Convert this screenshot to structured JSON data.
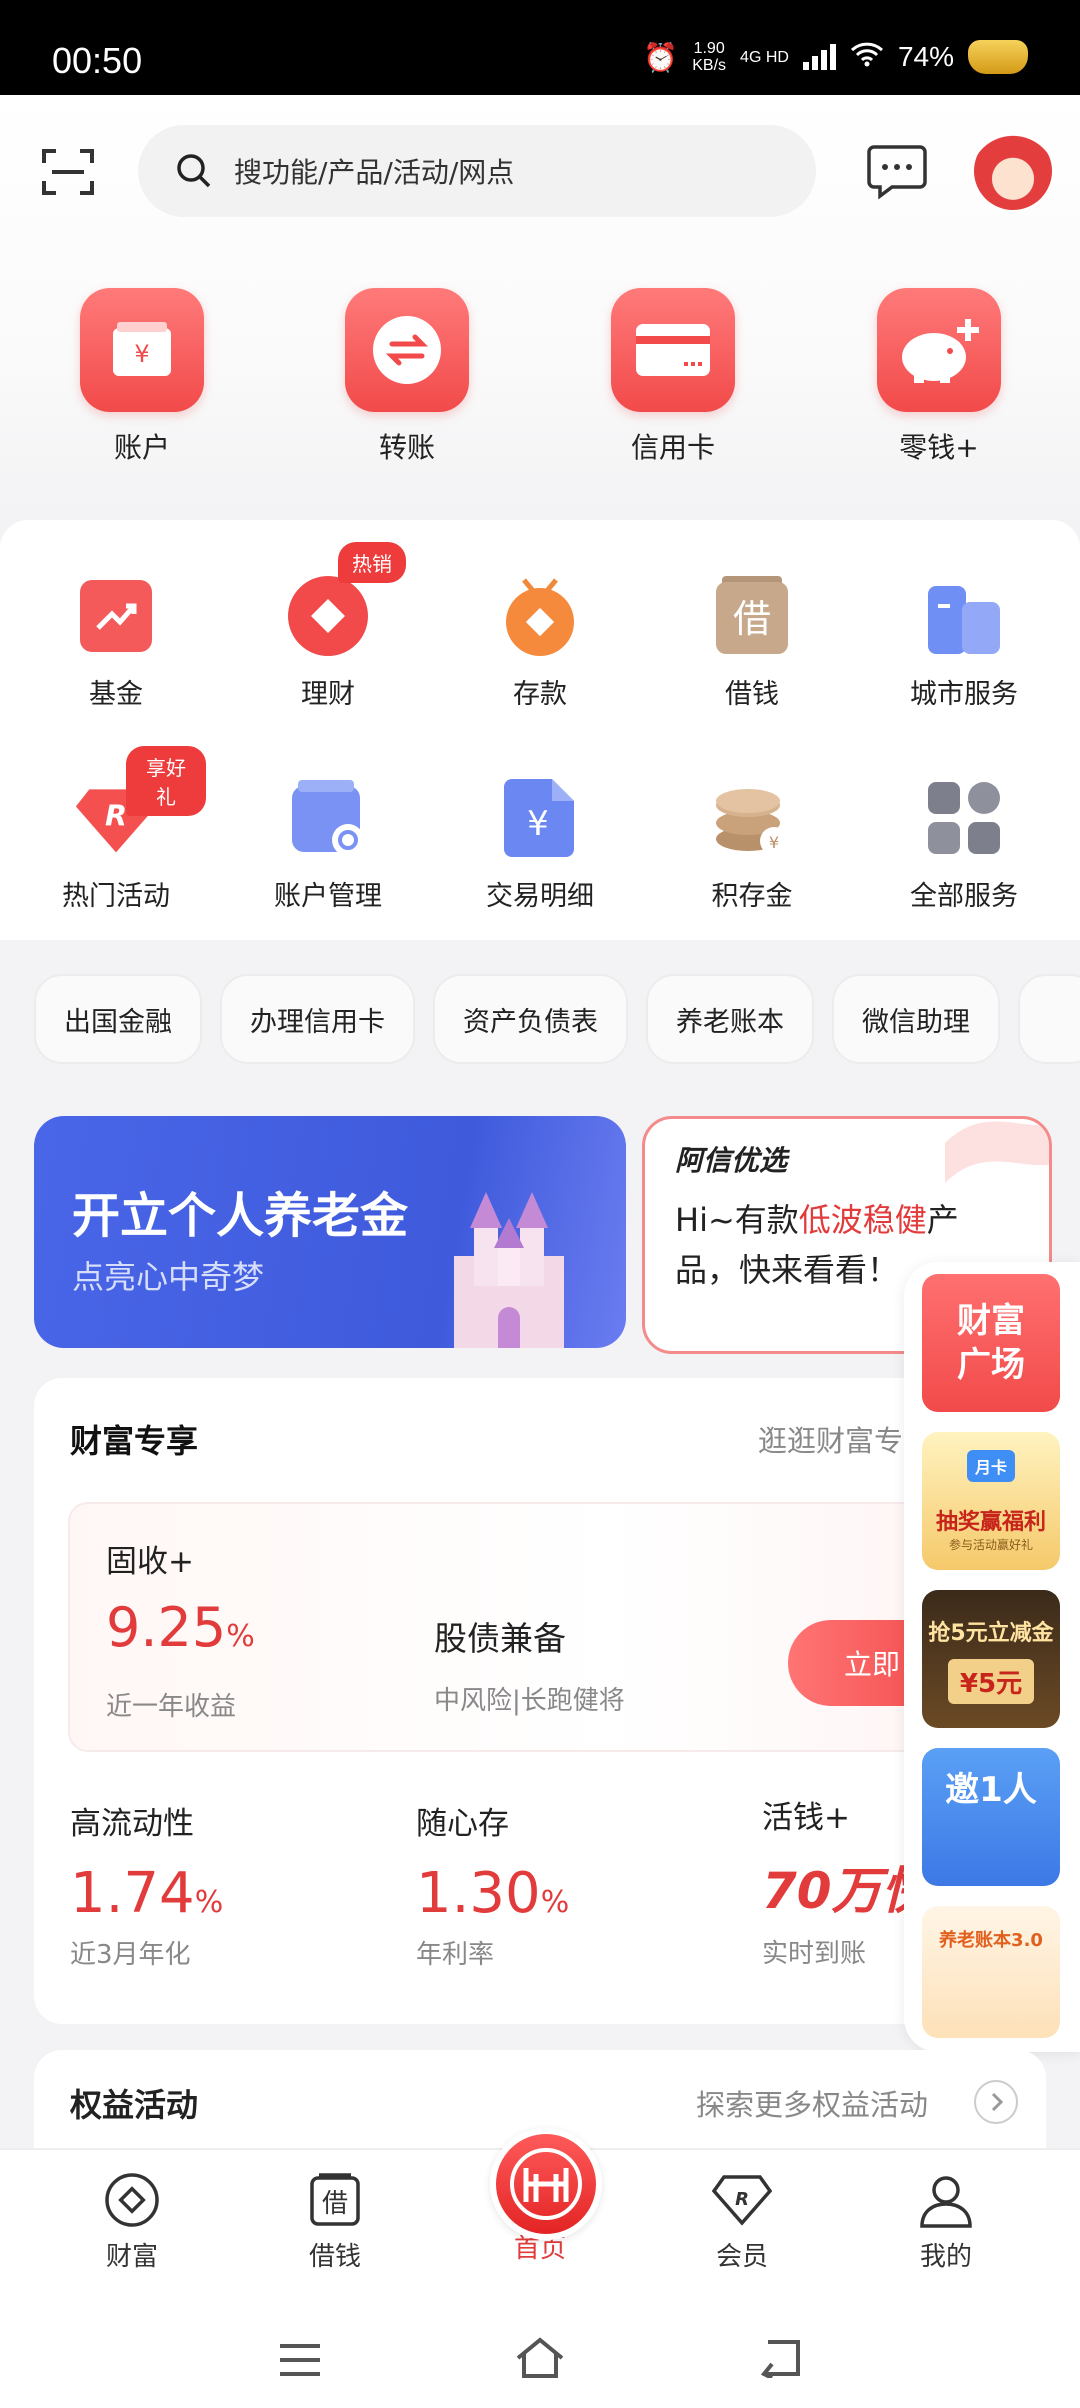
{
  "status_bar": {
    "time": "00:50",
    "speed_value": "1.90",
    "speed_unit": "KB/s",
    "network": "4G HD",
    "battery": "74%"
  },
  "search": {
    "placeholder": "搜功能/产品/活动/网点"
  },
  "top_actions": [
    {
      "label": "账户",
      "icon": "wallet-icon"
    },
    {
      "label": "转账",
      "icon": "transfer-icon"
    },
    {
      "label": "信用卡",
      "icon": "credit-card-icon"
    },
    {
      "label": "零钱+",
      "icon": "piggy-bank-icon"
    }
  ],
  "services": [
    {
      "label": "基金",
      "icon": "fund-icon"
    },
    {
      "label": "理财",
      "icon": "wealth-icon",
      "badge": "热销"
    },
    {
      "label": "存款",
      "icon": "deposit-icon"
    },
    {
      "label": "借钱",
      "icon": "loan-icon",
      "glyph": "借"
    },
    {
      "label": "城市服务",
      "icon": "city-service-icon"
    },
    {
      "label": "热门活动",
      "icon": "hot-activity-icon",
      "badge": "享好礼"
    },
    {
      "label": "账户管理",
      "icon": "account-manage-icon"
    },
    {
      "label": "交易明细",
      "icon": "transaction-detail-icon",
      "glyph": "¥"
    },
    {
      "label": "积存金",
      "icon": "gold-accumulation-icon"
    },
    {
      "label": "全部服务",
      "icon": "all-services-icon"
    }
  ],
  "chips": [
    "出国金融",
    "办理信用卡",
    "资产负债表",
    "养老账本",
    "微信助理"
  ],
  "banners": {
    "pension": {
      "title": "开立个人养老金",
      "subtitle": "点亮心中奇梦"
    },
    "promo": {
      "brand": "阿信优选",
      "text_pre": "Hi~有款",
      "text_highlight": "低波稳健",
      "text_post": "产品，快来看看！"
    }
  },
  "floating_ads": [
    {
      "text": "财富广场"
    },
    {
      "text": "抽奖赢福利",
      "sub": "参与活动赢好礼",
      "tag": "月卡"
    },
    {
      "text": "抢5元立减金",
      "sub": "¥5元"
    },
    {
      "text": "邀1人"
    },
    {
      "text": "养老账本3.0"
    }
  ],
  "wealth": {
    "title": "财富专享",
    "more": "逛逛财富专",
    "featured": {
      "name": "固收+",
      "rate": "9.25",
      "rate_unit": "%",
      "rate_label": "近一年收益",
      "tagline": "股债兼备",
      "risk": "中风险|长跑健将",
      "button": "立即"
    },
    "items": [
      {
        "name": "高流动性",
        "rate": "1.74",
        "unit": "%",
        "label": "近3月年化"
      },
      {
        "name": "随心存",
        "rate": "1.30",
        "unit": "%",
        "label": "年利率"
      },
      {
        "name": "活钱+",
        "highlight": "70万快",
        "label": "实时到账"
      }
    ]
  },
  "equity": {
    "title": "权益活动",
    "more": "探索更多权益活动"
  },
  "tabbar": [
    {
      "label": "财富",
      "icon": "wealth-tab-icon"
    },
    {
      "label": "借钱",
      "icon": "loan-tab-icon",
      "glyph": "借"
    },
    {
      "label": "首页",
      "icon": "home-logo-icon",
      "active": true
    },
    {
      "label": "会员",
      "icon": "member-tab-icon"
    },
    {
      "label": "我的",
      "icon": "profile-tab-icon"
    }
  ],
  "colors": {
    "accent": "#e23b3b",
    "tile": "#f24a4a",
    "banner_blue": "#4a66e8"
  }
}
